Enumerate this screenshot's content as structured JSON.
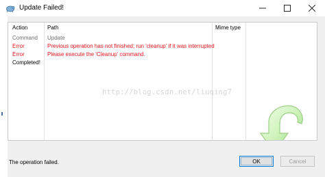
{
  "window": {
    "title": "Update Failed!",
    "controls": {
      "minimize": "—",
      "maximize": "☐",
      "close": "✕"
    }
  },
  "table": {
    "columns": [
      "Action",
      "Path",
      "Mime type"
    ],
    "rows": [
      {
        "action": "Command",
        "path": "Update",
        "style": "gray"
      },
      {
        "action": "Error",
        "path": "Previous operation has not finished; run 'cleanup' if it was interrupted",
        "style": "red"
      },
      {
        "action": "Error",
        "path": "Please execute the 'Cleanup' command.",
        "style": "red"
      },
      {
        "action": "Completed!",
        "path": "",
        "style": "black"
      }
    ]
  },
  "watermark": "http://blog.csdn.net/liuqing7",
  "status": {
    "message": "The operation failed."
  },
  "buttons": {
    "ok": "OK",
    "cancel": "Cancel"
  },
  "colors": {
    "error": "#e8151b",
    "command": "#6d6d6d",
    "accent": "#0078d7",
    "arrow": "#c8f0b4"
  },
  "icons": {
    "app": "tortoise-icon",
    "decoration": "green-curved-arrow-icon"
  }
}
